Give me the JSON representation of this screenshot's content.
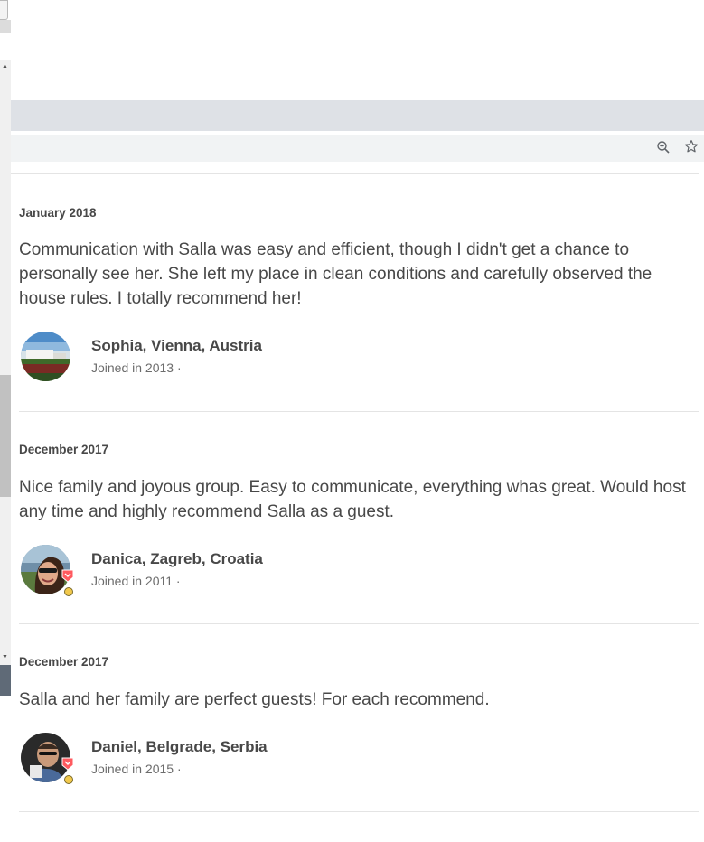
{
  "browser": {
    "zoom_icon": "zoom-in-icon",
    "bookmark_icon": "star-icon"
  },
  "reviews": [
    {
      "date": "January 2018",
      "text": "Communication with Salla was easy and efficient, though I didn't get a chance to personally see her. She left my place in clean conditions and carefully observed the house rules. I totally recommend her!",
      "reviewer": "Sophia, Vienna, Austria",
      "joined": "Joined in 2013 ·",
      "superhost_badge": false
    },
    {
      "date": "December 2017",
      "text": "Nice family and joyous group. Easy to communicate, everything whas great. Would host any time and highly recommend Salla as a guest.",
      "reviewer": "Danica, Zagreb, Croatia",
      "joined": "Joined in 2011 ·",
      "superhost_badge": true
    },
    {
      "date": "December 2017",
      "text": "Salla and her family are perfect guests! For each recommend.",
      "reviewer": "Daniel, Belgrade, Serbia",
      "joined": "Joined in 2015 ·",
      "superhost_badge": true
    }
  ],
  "colors": {
    "text": "#484848",
    "muted": "#6c6c6c",
    "divider": "#e4e4e4",
    "badge_red": "#ff5a5f",
    "badge_gold": "#f2c94c"
  }
}
